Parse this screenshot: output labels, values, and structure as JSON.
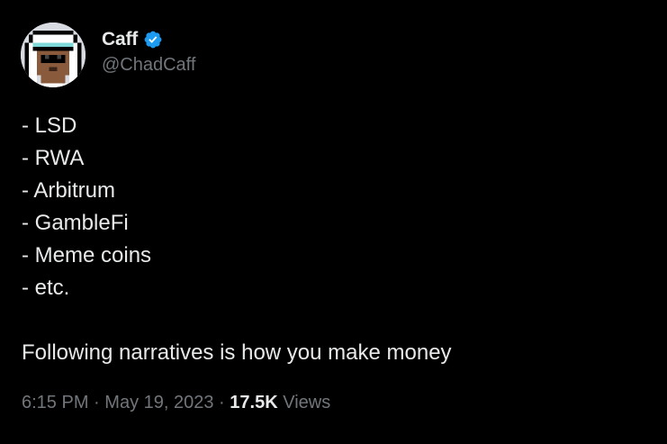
{
  "author": {
    "display_name": "Caff",
    "handle": "@ChadCaff",
    "verified": true,
    "avatar_icon": "pixel-punk-avatar-icon",
    "verified_icon": "verified-badge-icon"
  },
  "tweet": {
    "lines": [
      "- LSD",
      "- RWA",
      "- Arbitrum",
      "- GambleFi",
      "- Meme coins",
      "- etc."
    ],
    "closing": "Following narratives is how you make money"
  },
  "meta": {
    "time": "6:15 PM",
    "separator": "·",
    "date": "May 19, 2023",
    "views_count": "17.5K",
    "views_label": "Views"
  },
  "colors": {
    "background": "#000000",
    "text_primary": "#e7e9ea",
    "text_secondary": "#71767b",
    "verified_blue": "#1d9bf0"
  }
}
